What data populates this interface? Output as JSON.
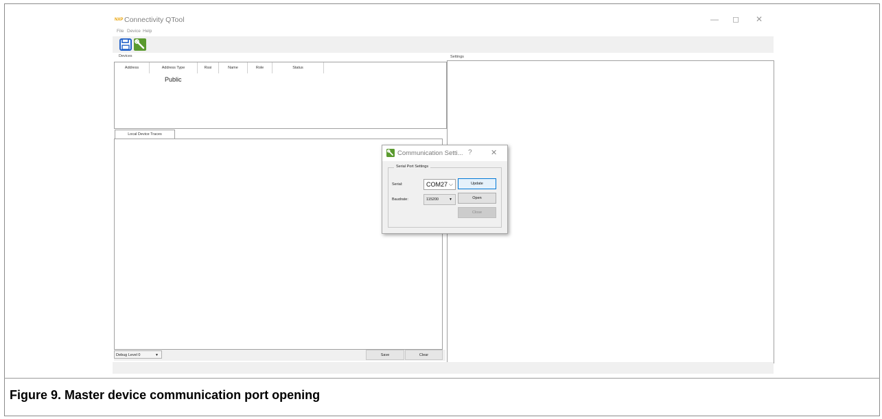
{
  "app": {
    "logo_text": "NXP",
    "title": "Connectivity QTool"
  },
  "window_controls": {
    "minimize": "—",
    "restore": "◻",
    "close": "✕"
  },
  "menu": [
    "File",
    "Device",
    "Help"
  ],
  "toolbar": {
    "save_icon": "floppy-disk-icon",
    "settings_icon": "wrench-icon"
  },
  "devices": {
    "label": "Devices",
    "columns": [
      "Address",
      "Address Type",
      "Rssi",
      "Name",
      "Role",
      "Status"
    ],
    "rows": [
      {
        "address": "",
        "address_type": "Public",
        "rssi": "",
        "name": "",
        "role": "",
        "status": ""
      }
    ]
  },
  "traces": {
    "tab_label": "Local Device Traces",
    "debug_level": "Debug Level 0",
    "save_label": "Save",
    "clear_label": "Clear"
  },
  "settings": {
    "label": "Settings"
  },
  "dialog": {
    "title": "Communication Setti...",
    "help": "?",
    "close": "✕",
    "group_title": "Serial Port Settings",
    "serial_label": "Serial:",
    "serial_value": "COM27",
    "baud_label": "Baudrate:",
    "baud_value": "115200",
    "update_label": "Update",
    "open_label": "Open",
    "close_label": "Close"
  },
  "caption": "Figure 9. Master device communication port opening",
  "colors": {
    "accent_blue": "#0078d7",
    "icon_green": "#5a9a2e",
    "floppy_blue": "#1f5fc8"
  }
}
